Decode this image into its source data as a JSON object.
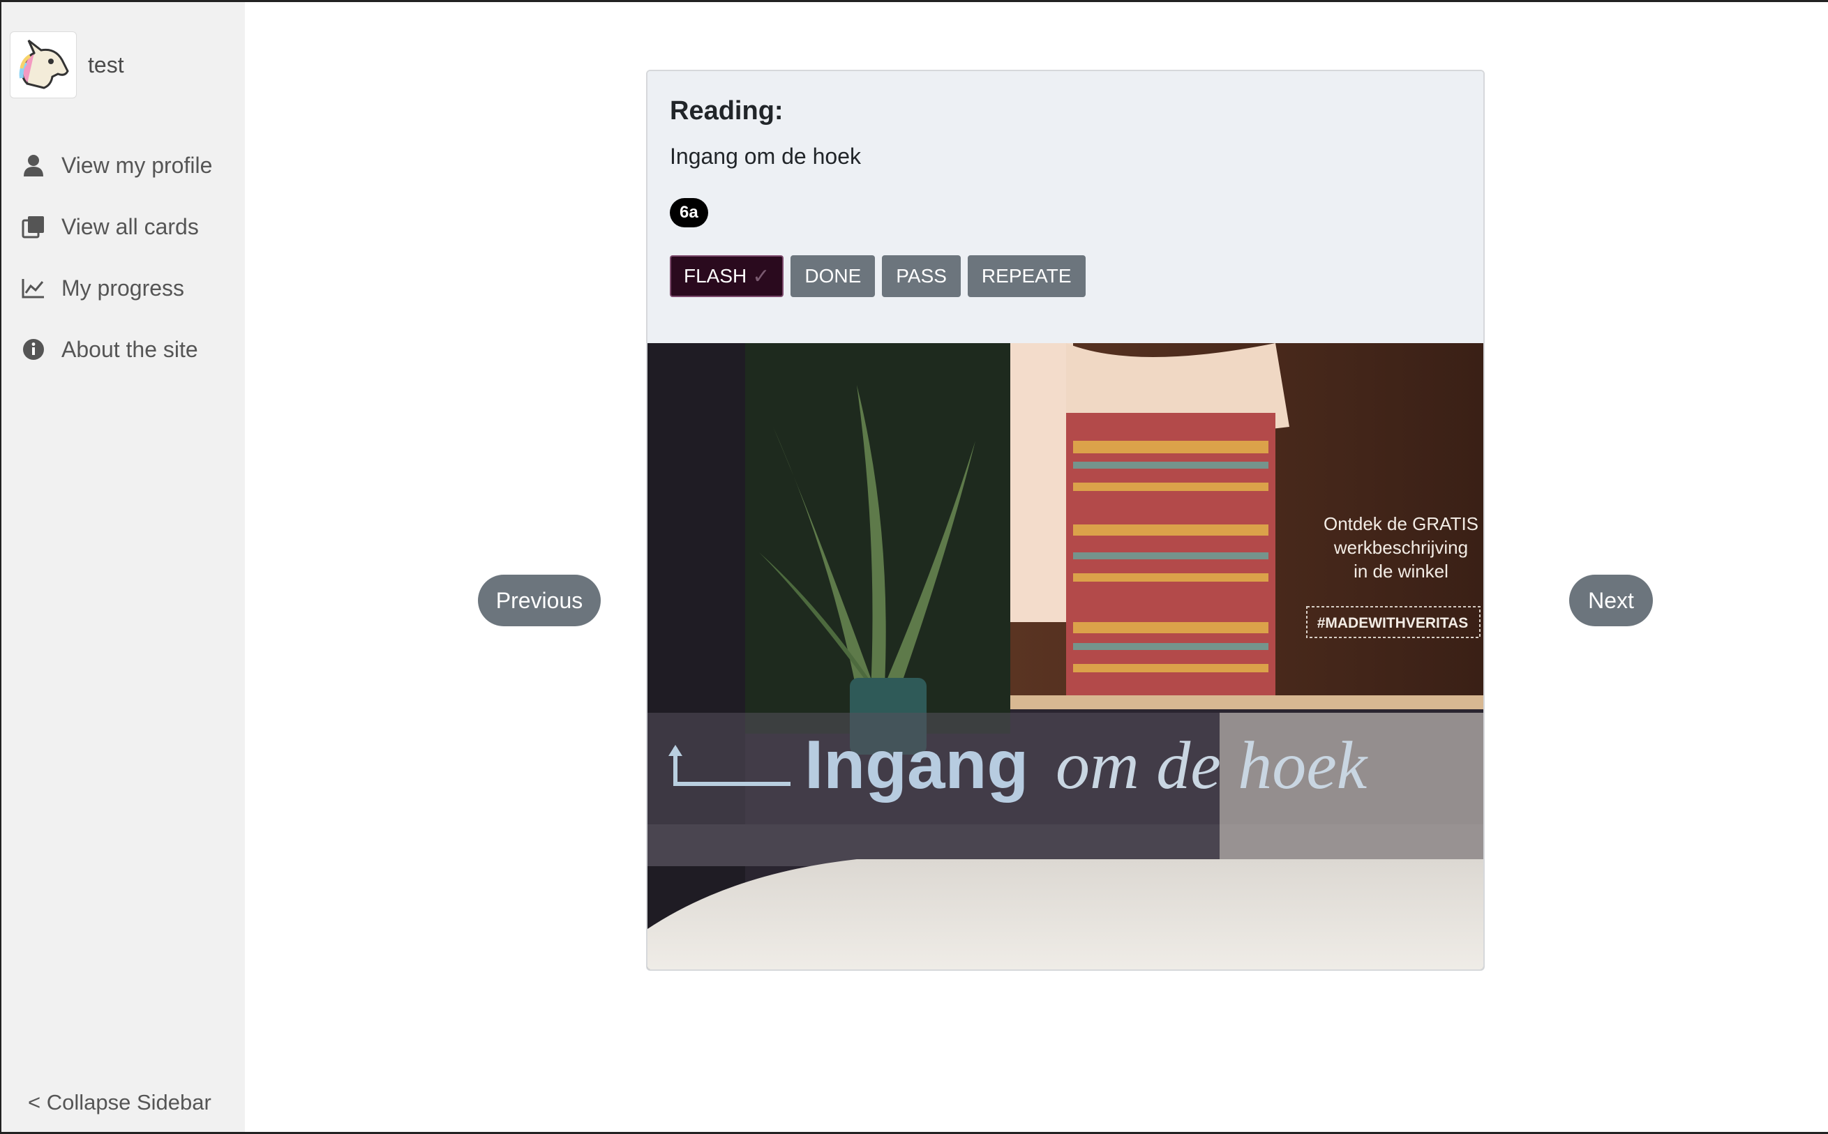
{
  "user": {
    "name": "test",
    "avatar_icon": "unicorn-icon"
  },
  "sidebar": {
    "items": [
      {
        "label": "View my profile",
        "icon": "user-icon"
      },
      {
        "label": "View all cards",
        "icon": "cards-icon"
      },
      {
        "label": "My progress",
        "icon": "chart-line-icon"
      },
      {
        "label": "About the site",
        "icon": "info-icon"
      }
    ],
    "collapse_label": "< Collapse Sidebar"
  },
  "card": {
    "title": "Reading:",
    "text": "Ingang om de hoek",
    "badge": "6a",
    "buttons": [
      {
        "label": "FLASH",
        "checked": true
      },
      {
        "label": "DONE"
      },
      {
        "label": "PASS"
      },
      {
        "label": "REPEATE"
      }
    ],
    "photo": {
      "sign_text_main": "Ingang",
      "sign_text_italic": "om de hoek",
      "poster_lines": [
        "Ontdek de GRATIS",
        "werkbeschrijving",
        "in de winkel"
      ],
      "hashtag": "#MADEWITHVERITAS"
    }
  },
  "pager": {
    "previous_label": "Previous",
    "next_label": "Next"
  },
  "colors": {
    "sidebar_bg": "#f1f1f1",
    "button_gray": "#6c757d",
    "active_button": "#2a0a1e",
    "card_header_bg": "#edf0f4"
  }
}
